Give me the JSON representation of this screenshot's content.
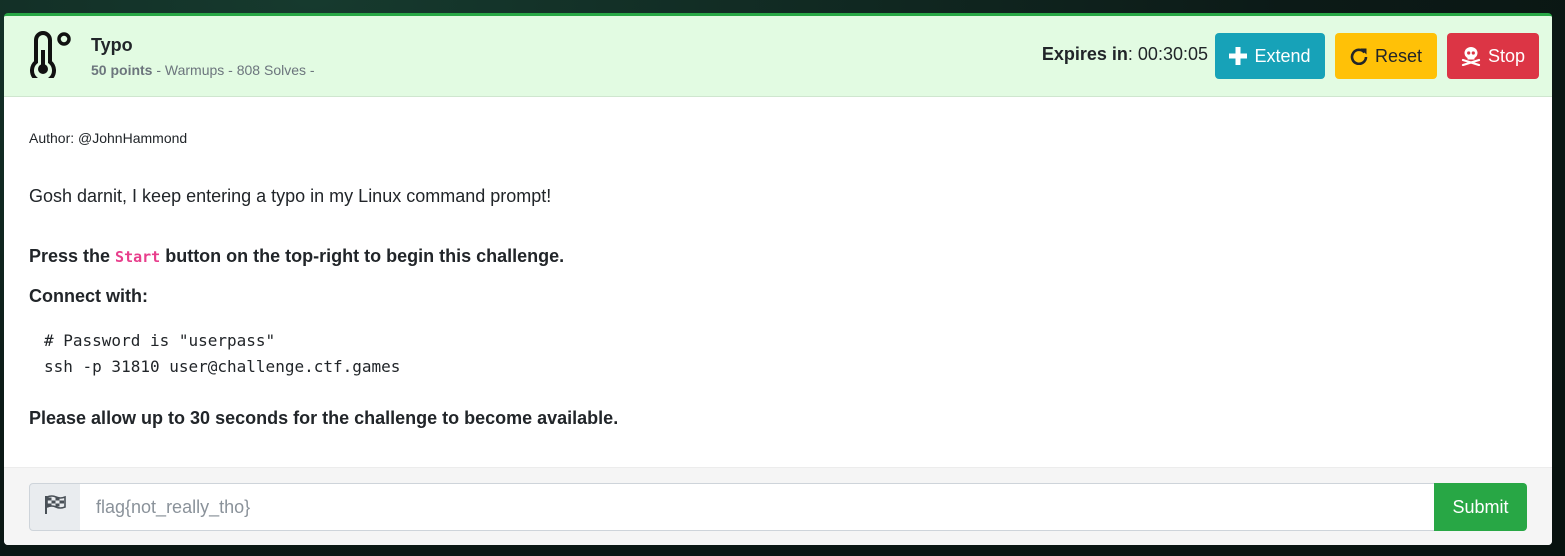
{
  "challenge": {
    "title": "Typo",
    "points": "50 points",
    "meta_rest": " - Warmups - 808 Solves -",
    "category_icon": "thermometer-icon"
  },
  "header": {
    "expires_label": "Expires in",
    "expires_value": ": 00:30:05",
    "extend_label": "Extend",
    "reset_label": "Reset",
    "stop_label": "Stop"
  },
  "body": {
    "author": "Author: @JohnHammond",
    "description": "Gosh darnit, I keep entering a typo in my Linux command prompt!",
    "press_before": "Press the ",
    "press_code": "Start",
    "press_after": " button on the top-right to begin this challenge.",
    "connect_label": "Connect with:",
    "code_line1": "# Password is \"userpass\"",
    "code_line2": "ssh -p 31810 user@challenge.ctf.games",
    "allow_note": "Please allow up to 30 seconds for the challenge to become available."
  },
  "footer": {
    "flag_placeholder": "flag{not_really_tho}",
    "flag_value": "",
    "submit_label": "Submit",
    "flag_icon": "flag-checkered-icon"
  },
  "colors": {
    "header_bg": "#e2fbe2",
    "extend": "#17a2b8",
    "reset": "#ffc107",
    "stop": "#dc3545",
    "submit": "#28a745",
    "code_accent": "#e83e8c"
  }
}
